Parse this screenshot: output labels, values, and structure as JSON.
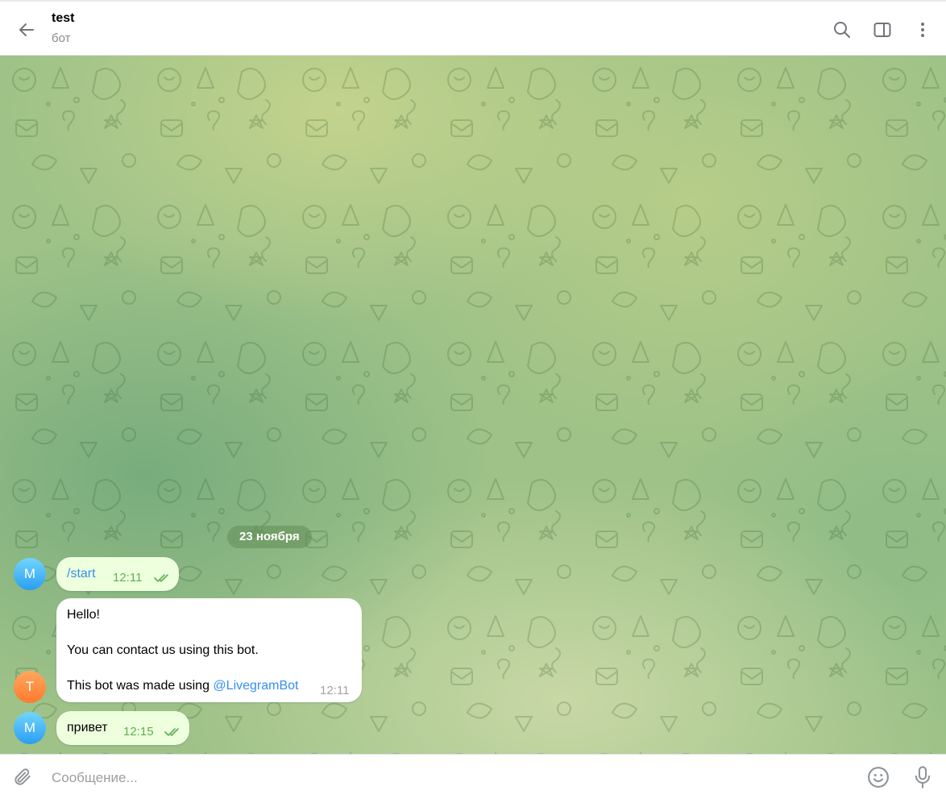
{
  "header": {
    "title": "test",
    "subtitle": "бот",
    "icons": [
      "back-arrow-icon",
      "search-icon",
      "sidebar-toggle-icon",
      "more-vertical-icon"
    ]
  },
  "date_separator": "23 ноября",
  "messages": [
    {
      "direction": "out",
      "avatar_letter": "M",
      "text": "/start",
      "time": "12:11",
      "status_icon": "double-check-icon"
    },
    {
      "direction": "in",
      "avatar_letter": "T",
      "line1": "Hello!",
      "line2": "You can contact us using this bot.",
      "line3_prefix": "This bot was made using ",
      "line3_mention": "@LivegramBot",
      "time": "12:11"
    },
    {
      "direction": "out",
      "avatar_letter": "M",
      "text": "привет",
      "time": "12:15",
      "status_icon": "double-check-icon"
    }
  ],
  "composer": {
    "placeholder": "Сообщение...",
    "value": "",
    "icons": [
      "attach-icon",
      "emoji-icon",
      "microphone-icon"
    ]
  },
  "colors": {
    "accent": "#3390ec",
    "outgoing_bubble": "#eeffde",
    "outgoing_time": "#5fae53",
    "avatar_m": "#2a9ef1",
    "avatar_t": "#ff7a2f"
  }
}
